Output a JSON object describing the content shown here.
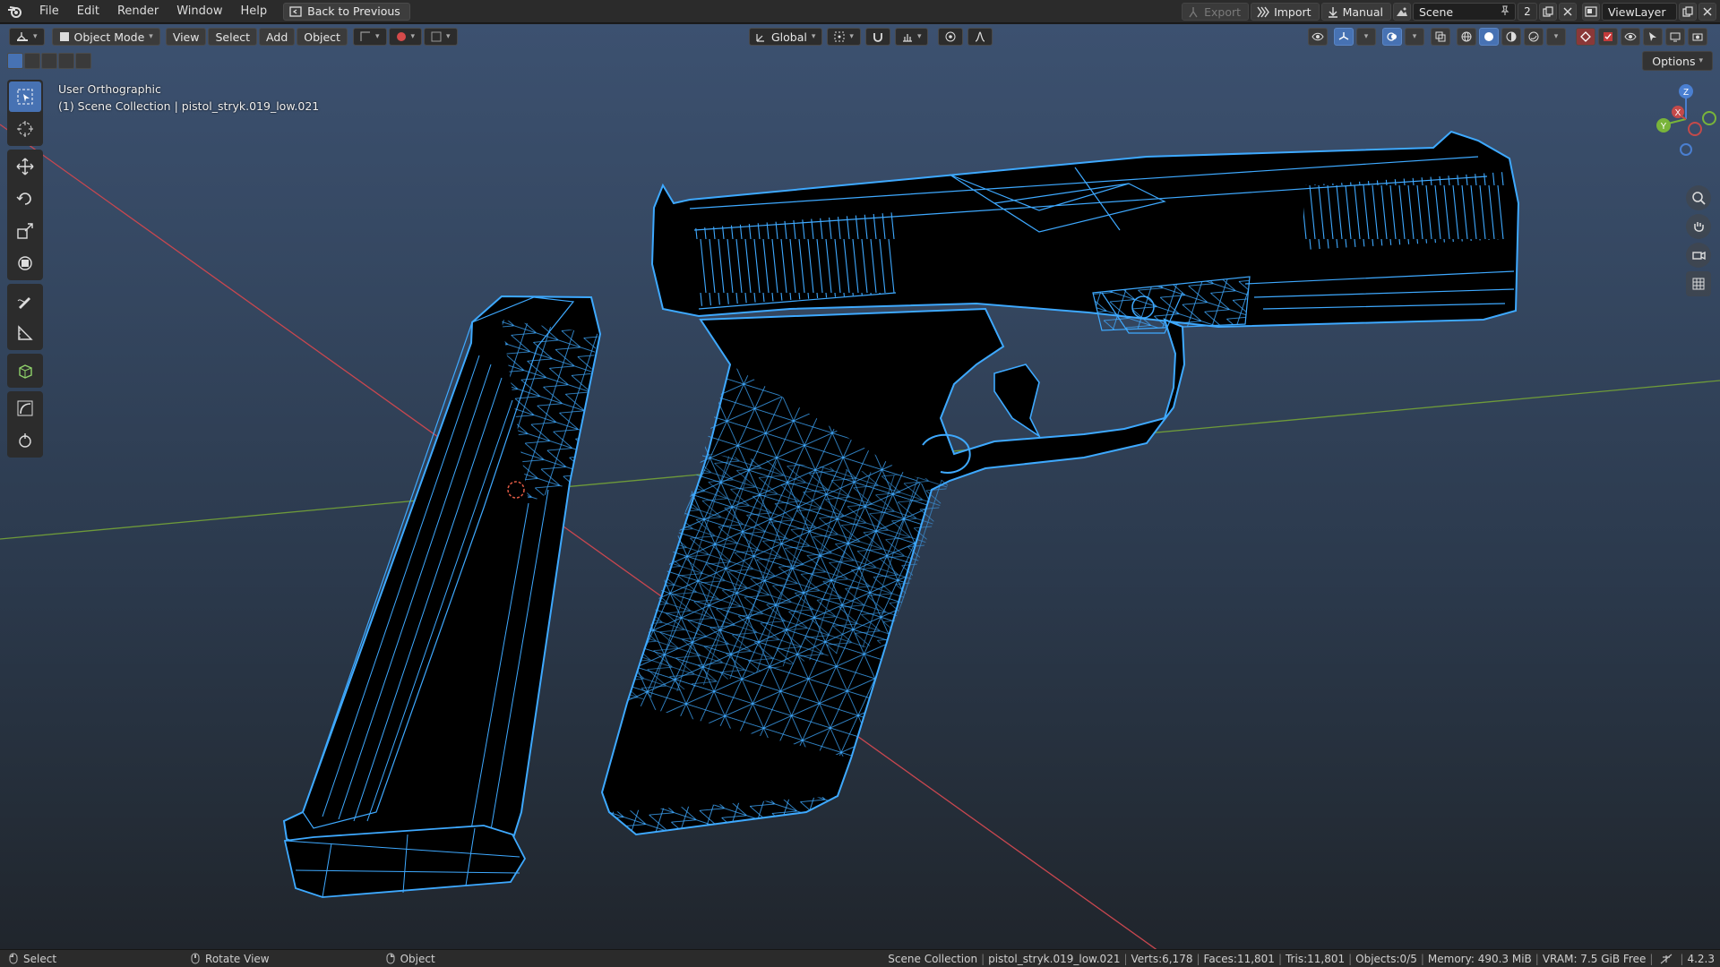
{
  "menu": {
    "items": [
      "File",
      "Edit",
      "Render",
      "Window",
      "Help"
    ],
    "back_label": "Back to Previous"
  },
  "topbar_right": {
    "export_label": "Export",
    "import_label": "Import",
    "manual_label": "Manual",
    "scene_name": "Scene",
    "scene_count": "2",
    "view_layer": "ViewLayer"
  },
  "viewport_header": {
    "mode_label": "Object Mode",
    "view_label": "View",
    "select_label": "Select",
    "add_label": "Add",
    "object_label": "Object",
    "transform_orientation": "Global",
    "options_label": "Options"
  },
  "viewport_info": {
    "view_name": "User Orthographic",
    "collection_line": "(1) Scene Collection | pistol_stryk.019_low.021"
  },
  "gizmo": {
    "z": "Z",
    "y": "Y",
    "x": "X"
  },
  "statusbar": {
    "select_hint": "Select",
    "rotate_hint": "Rotate View",
    "object_hint": "Object",
    "stats": [
      "Scene Collection",
      "pistol_stryk.019_low.021",
      "Verts:6,178",
      "Faces:11,801",
      "Tris:11,801",
      "Objects:0/5",
      "Memory: 490.3 MiB",
      "VRAM: 7.5 GiB Free"
    ],
    "version": "4.2.3"
  },
  "colors": {
    "wire": "#3ea9ff",
    "axis_x": "#c8474f",
    "axis_y": "#6e9a3a",
    "active_blue": "#4772b3"
  }
}
